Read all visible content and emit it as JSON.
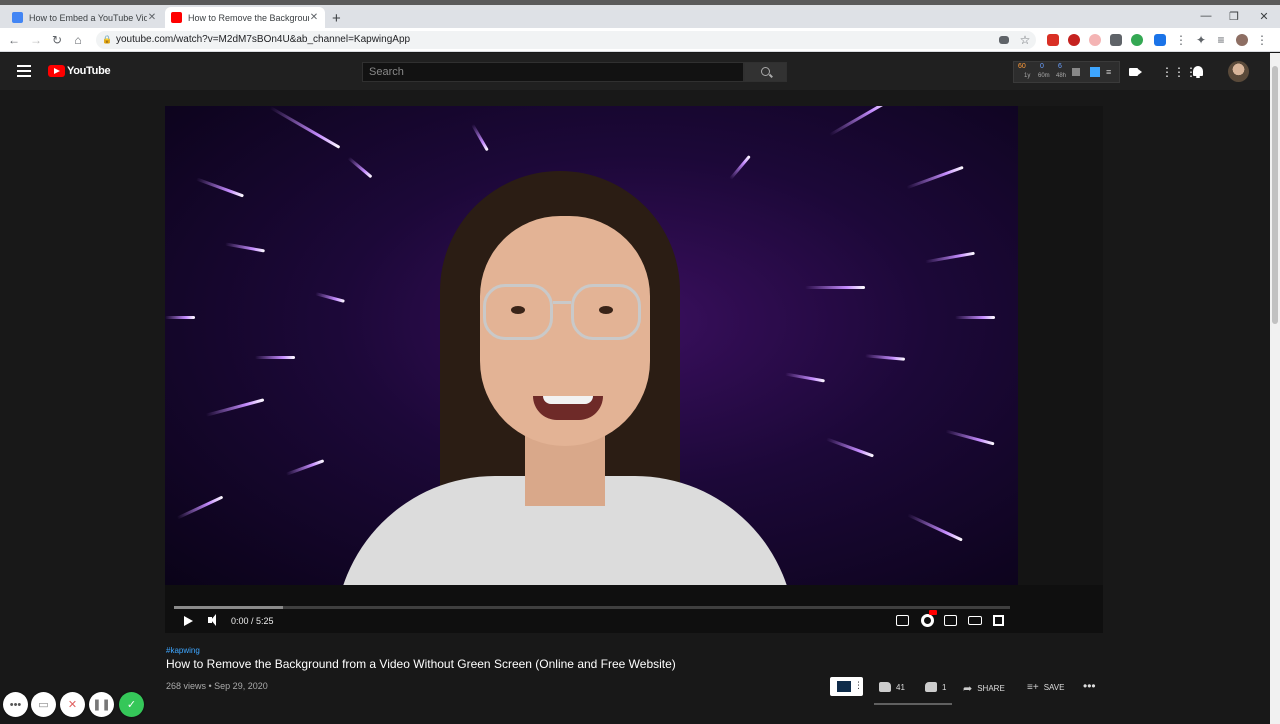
{
  "browser": {
    "tabs": [
      {
        "title": "How to Embed a YouTube Video",
        "favicon_color": "#4285f4",
        "active": false
      },
      {
        "title": "How to Remove the Background",
        "favicon_color": "#ff0000",
        "active": true
      }
    ],
    "url": "youtube.com/watch?v=M2dM7sBOn4U&ab_channel=KapwingApp"
  },
  "youtube": {
    "logo_text": "YouTube",
    "search_placeholder": "Search",
    "stats": {
      "values": [
        "60",
        "0",
        "6"
      ],
      "sublabels": [
        "1y",
        "60m",
        "48h"
      ]
    }
  },
  "player": {
    "time": "0:00 / 5:25",
    "progress_buffered": 0.13
  },
  "video_info": {
    "hashtag": "#kapwing",
    "title": "How to Remove the Background from a Video Without Green Screen (Online and Free Website)",
    "meta": "268 views • Sep 29, 2020",
    "likes": "41",
    "dislikes": "1",
    "share_label": "SHARE",
    "save_label": "SAVE"
  },
  "colors": {
    "brand": "#ff0000",
    "link": "#3ea6ff",
    "confirm": "#35c759"
  }
}
